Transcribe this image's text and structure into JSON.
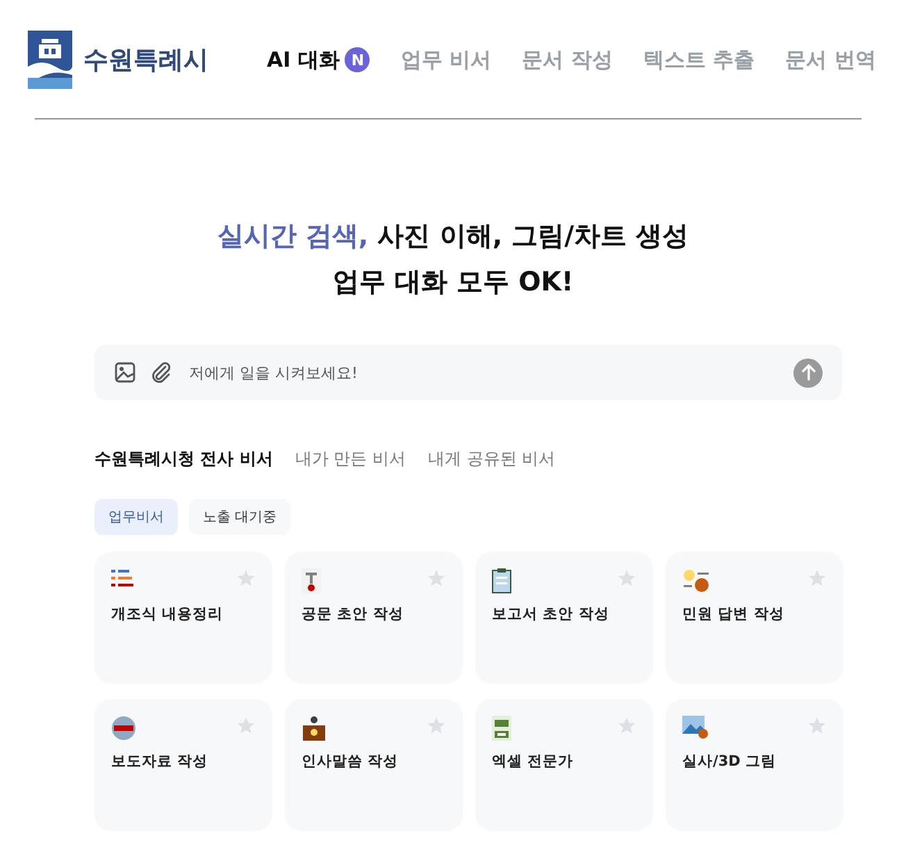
{
  "logo": {
    "text": "수원특례시"
  },
  "nav": [
    {
      "label": "AI 대화",
      "selected": true,
      "badge": "N"
    },
    {
      "label": "업무 비서",
      "selected": false
    },
    {
      "label": "문서 작성",
      "selected": false
    },
    {
      "label": "텍스트 추출",
      "selected": false
    },
    {
      "label": "문서 번역",
      "selected": false
    }
  ],
  "headline": {
    "line_1": [
      {
        "text": "실시간 검색,",
        "accent": true
      },
      {
        "text": " 사진 이해, 그림/차트 생성",
        "accent": false
      }
    ],
    "line_2": "업무 대화 모두 OK!"
  },
  "prompt": {
    "placeholder": "저에게 일을 시켜보세요!"
  },
  "assistant_tabs": [
    {
      "label": "수원특례시청 전사 비서",
      "selected": true
    },
    {
      "label": "내가 만든 비서",
      "selected": false
    },
    {
      "label": "내게 공유된 비서",
      "selected": false
    }
  ],
  "filters": [
    {
      "label": "업무비서",
      "selected": true
    },
    {
      "label": "노출 대기중",
      "selected": false
    }
  ],
  "cards": [
    {
      "title": "개조식 내용정리",
      "favorite": false
    },
    {
      "title": "공문 초안 작성",
      "favorite": false
    },
    {
      "title": "보고서 초안 작성",
      "favorite": false
    },
    {
      "title": "민원 답변 작성",
      "favorite": false
    },
    {
      "title": "보도자료 작성",
      "favorite": false
    },
    {
      "title": "인사말씀 작성",
      "favorite": false
    },
    {
      "title": "엑셀 전문가",
      "favorite": false
    },
    {
      "title": "실사/3D 그림",
      "favorite": false
    }
  ]
}
